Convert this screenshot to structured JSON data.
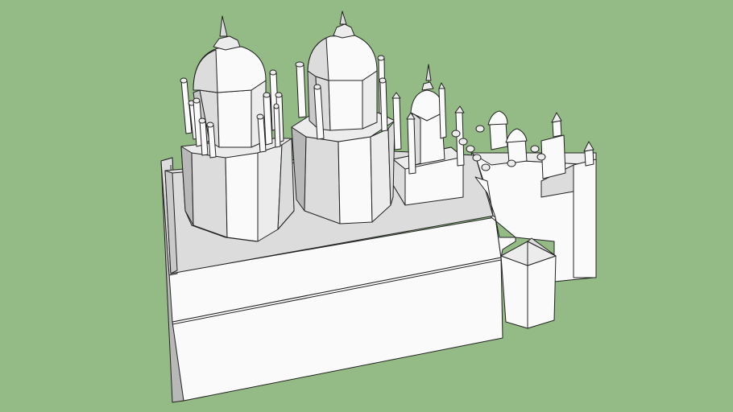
{
  "scene": {
    "background_color": "#94bb85",
    "model_color": "#f2f2f2",
    "edge_color": "#222222"
  }
}
